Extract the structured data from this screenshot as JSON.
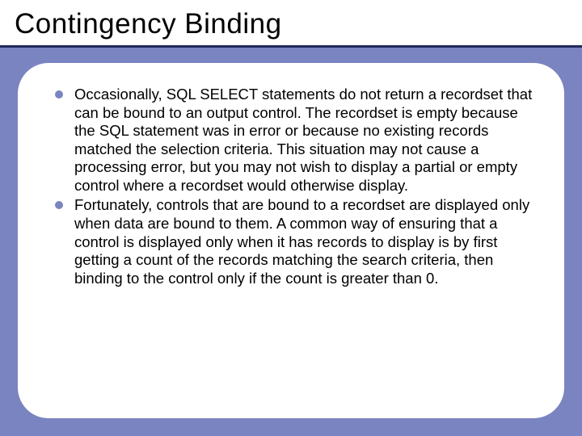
{
  "slide": {
    "title": "Contingency Binding",
    "bullets": [
      "Occasionally, SQL SELECT statements do not return a recordset that can be bound to an output control. The recordset is empty because the SQL statement was in error or because no existing records matched the selection criteria. This situation may not cause a processing error, but you may not wish to display a partial or empty control where a recordset would otherwise display.",
      "Fortunately, controls that are bound to a recordset are displayed only when data are bound to them. A common way of ensuring that a control is displayed only when it has records to display is by first getting a count of the records matching the search criteria, then binding to the control only if the count is greater than 0."
    ]
  }
}
